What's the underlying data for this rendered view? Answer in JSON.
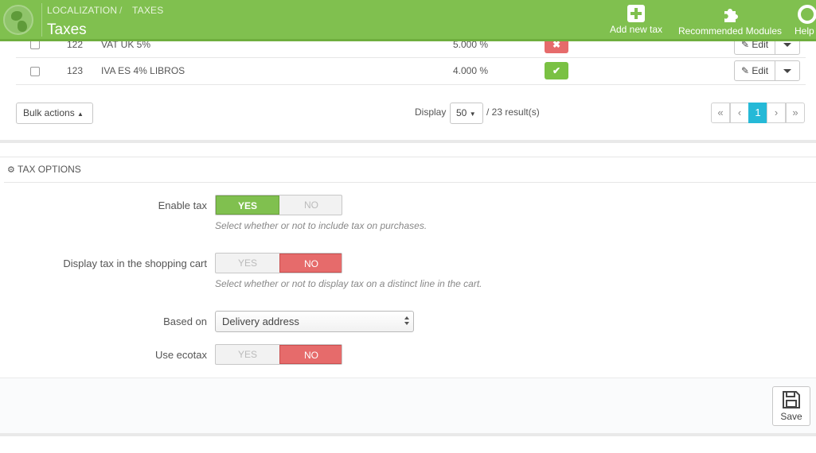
{
  "header": {
    "breadcrumb": [
      "LOCALIZATION",
      "/",
      "TAXES"
    ],
    "title": "Taxes",
    "actions": [
      {
        "label": "Add new tax",
        "icon": "plus-icon"
      },
      {
        "label": "Recommended Modules",
        "icon": "puzzle-icon"
      },
      {
        "label": "Help",
        "icon": "lifebuoy-icon"
      }
    ],
    "color": "#80c04f"
  },
  "table": {
    "rows": [
      {
        "id": "122",
        "name": "VAT UK 5%",
        "rate": "5.000 %",
        "enabled": false,
        "status_symbol": "✖",
        "edit_label": "Edit"
      },
      {
        "id": "123",
        "name": "IVA ES 4% LIBROS",
        "rate": "4.000 %",
        "enabled": true,
        "status_symbol": "✔",
        "edit_label": "Edit"
      }
    ]
  },
  "list_footer": {
    "bulk_label": "Bulk actions",
    "display_label": "Display",
    "per_page": "50",
    "results": "/ 23 result(s)",
    "pagination": [
      "«",
      "‹",
      "1",
      "›",
      "»"
    ],
    "current_page": "1"
  },
  "options": {
    "panel_title": "TAX OPTIONS",
    "fields": {
      "enable_tax": {
        "label": "Enable tax",
        "yes": "YES",
        "no": "NO",
        "value": "YES",
        "help": "Select whether or not to include tax on purchases."
      },
      "display_tax_cart": {
        "label": "Display tax in the shopping cart",
        "yes": "YES",
        "no": "NO",
        "value": "NO",
        "help": "Select whether or not to display tax on a distinct line in the cart."
      },
      "based_on": {
        "label": "Based on",
        "value": "Delivery address"
      },
      "use_ecotax": {
        "label": "Use ecotax",
        "yes": "YES",
        "no": "NO",
        "value": "NO"
      }
    },
    "save_label": "Save"
  },
  "colors": {
    "accent_green": "#80c04f",
    "accent_red": "#e66b6b",
    "pagination_active": "#25b9d7"
  }
}
